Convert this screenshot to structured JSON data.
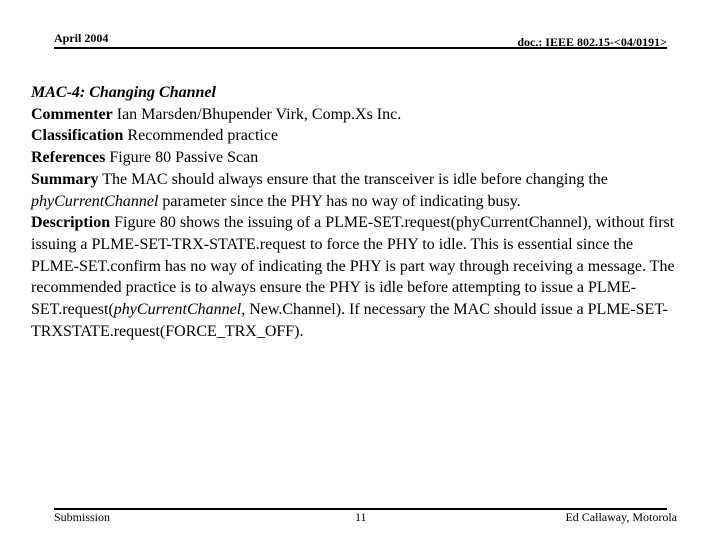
{
  "header": {
    "date": "April 2004",
    "doc_id": "doc.: IEEE 802.15-<04/0191>"
  },
  "content": {
    "title": "MAC-4: Changing Channel",
    "commenter": {
      "label": "Commenter",
      "value": " Ian Marsden/Bhupender Virk, Comp.Xs Inc."
    },
    "classification": {
      "label": "Classification",
      "value": " Recommended practice"
    },
    "references": {
      "label": "References",
      "value": " Figure 80 Passive Scan"
    },
    "summary": {
      "label": "Summary",
      "text_before": " The MAC should always ensure that the transceiver is idle before changing the ",
      "italic": "phyCurrentChannel",
      "text_after": " parameter since the PHY has no way of indicating busy."
    },
    "description": {
      "label": "Description",
      "text_before": " Figure 80 shows the issuing of a PLME-SET.request(phyCurrentChannel), without first issuing a PLME-SET-TRX-STATE.request to force the PHY to idle. This is essential since the PLME-SET.confirm has no way of indicating the PHY is part way through receiving a message. The recommended practice is to always ensure the PHY is idle before attempting to issue a PLME-SET.request(",
      "italic": "phyCurrentChannel",
      "text_after": ", New.Channel). If necessary the MAC should issue a PLME-SET-TRXSTATE.request(FORCE_TRX_OFF)."
    }
  },
  "footer": {
    "left": "Submission",
    "page": "11",
    "right": "Ed Callaway, Motorola"
  }
}
